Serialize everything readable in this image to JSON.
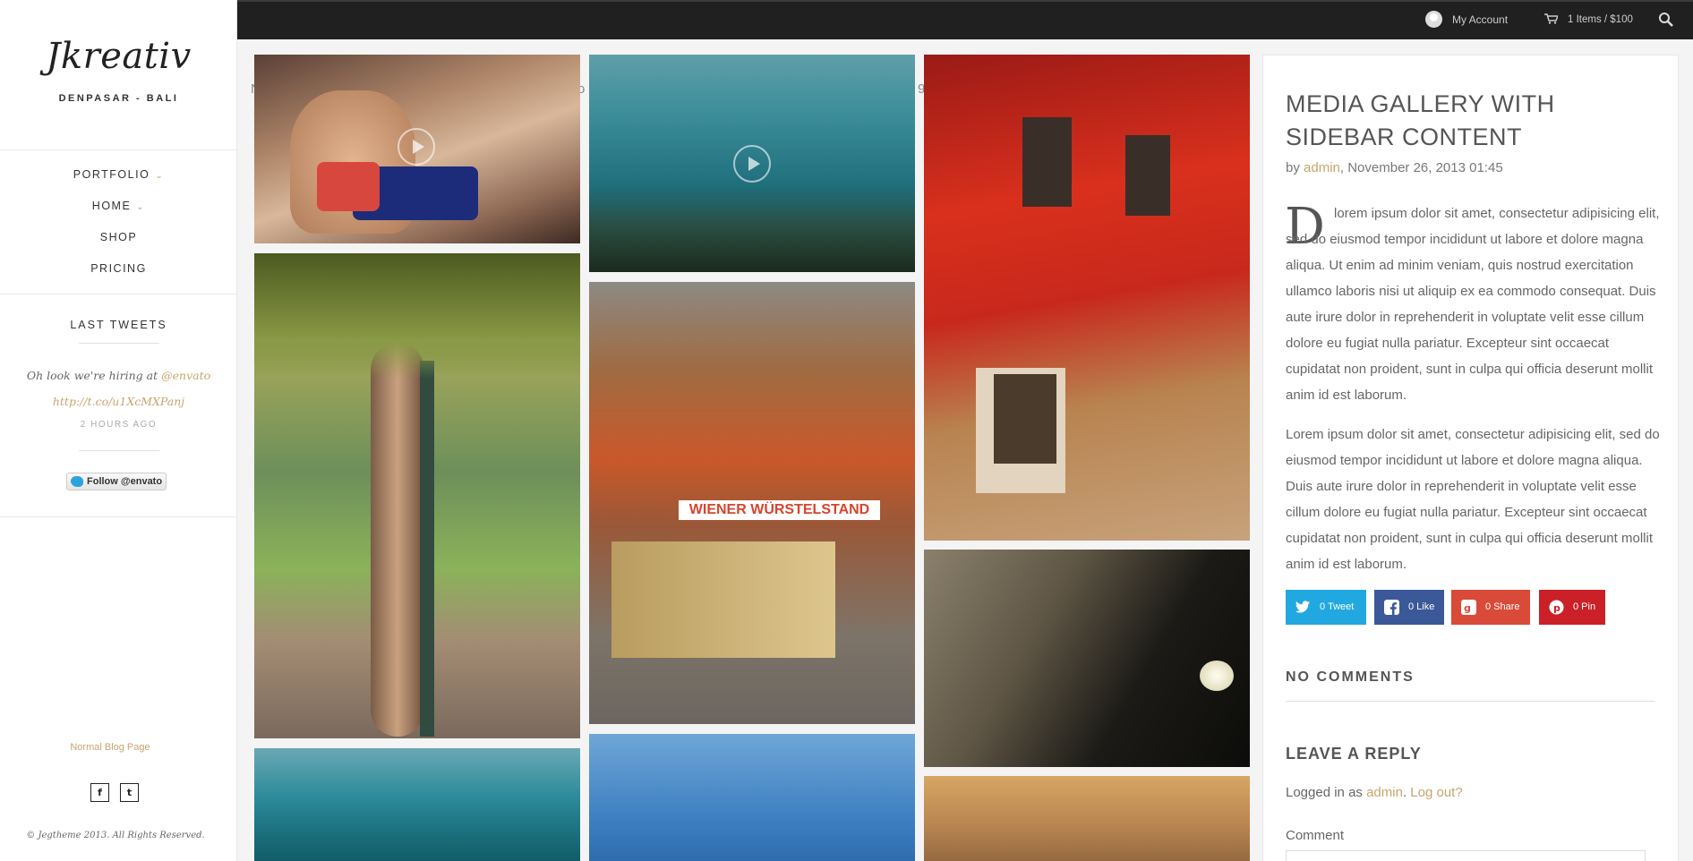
{
  "sidebar": {
    "logo": "Jkreativ",
    "tagline": "DENPASAR - BALI",
    "menu": [
      {
        "label": "PORTFOLIO",
        "has_caret": true
      },
      {
        "label": "HOME",
        "has_caret": true
      },
      {
        "label": "SHOP",
        "has_caret": false
      },
      {
        "label": "PRICING",
        "has_caret": false
      }
    ],
    "widget_title": "LAST TWEETS",
    "tweet_text": "Oh look we're hiring at",
    "tweet_mention": "@envato",
    "tweet_link": "http://t.co/u1XcMXPanj",
    "tweet_time": "2 HOURS AGO",
    "follow_label": "Follow @envato",
    "normal_link": "Normal Blog Page",
    "social": [
      "f",
      "t"
    ],
    "copyright": "© Jegtheme 2013. All Rights Reserved."
  },
  "topbar": {
    "account": "My Account",
    "cart": "1 Items / $100"
  },
  "post": {
    "title": "MEDIA GALLERY WITH SIDEBAR CONTENT",
    "meta_prefix": "by",
    "author": "admin",
    "meta_date": ", November 26, 2013 01:45",
    "dropcap": "D",
    "para1": "lorem ipsum dolor sit amet, consectetur adipisicing elit, sed do eiusmod tempor incididunt ut labore et dolore magna aliqua. Ut enim ad minim veniam, quis nostrud exercitation ullamco laboris nisi ut aliquip ex ea commodo consequat. Duis aute irure dolor in reprehenderit in voluptate velit esse cillum dolore eu fugiat nulla pariatur. Excepteur sint occaecat cupidatat non proident, sunt in culpa qui officia deserunt mollit anim id est laborum.",
    "para2": "Lorem ipsum dolor sit amet, consectetur adipisicing elit, sed do eiusmod tempor incididunt ut labore et dolore magna aliqua. Duis aute irure dolor in reprehenderit in voluptate velit esse cillum dolore eu fugiat nulla pariatur. Excepteur sint occaecat cupidatat non proident, sunt in culpa qui officia deserunt mollit anim id est laborum.",
    "share": [
      {
        "label": "0 Tweet",
        "color": "#22a8e0",
        "icon": "twitter-icon"
      },
      {
        "label": "0 Like",
        "color": "#3b5998",
        "icon": "facebook-icon"
      },
      {
        "label": "0 Share",
        "color": "#d94a38",
        "icon": "google-plus-icon"
      },
      {
        "label": "0 Pin",
        "color": "#cb2027",
        "icon": "pinterest-icon"
      }
    ],
    "no_comments": "NO COMMENTS",
    "leave_reply": "LEAVE A REPLY",
    "logged_prefix": "Logged in as",
    "logged_user": "admin",
    "logout": "Log out?",
    "comment_label": "Comment"
  },
  "gallery": {
    "faded_chars": [
      "N",
      "o",
      "9"
    ]
  },
  "colors": {
    "accent": "#c8a56c",
    "topbar": "#202020"
  }
}
